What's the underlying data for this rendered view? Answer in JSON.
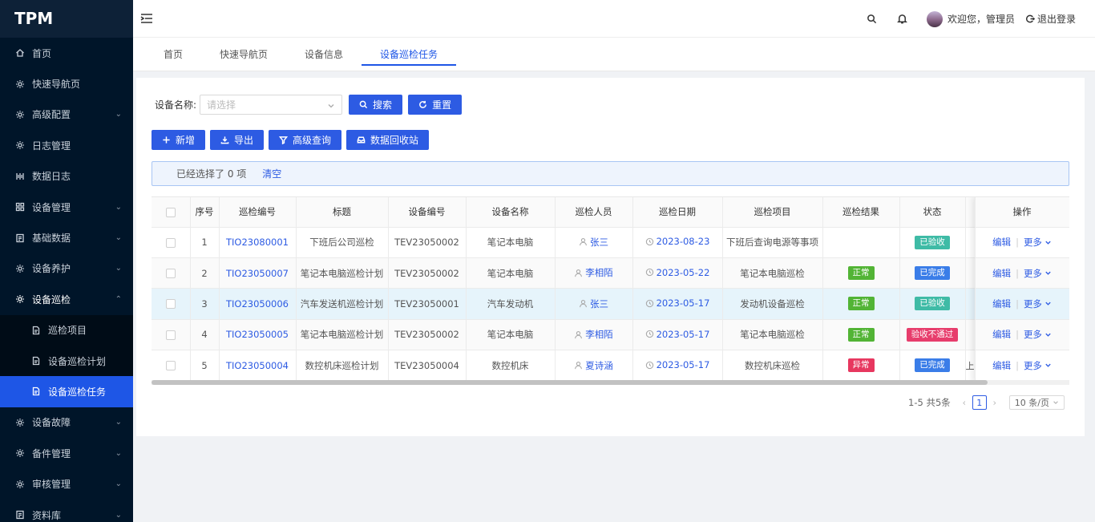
{
  "app": {
    "logo": "TPM"
  },
  "sidebar": {
    "items": [
      {
        "label": "首页",
        "icon": "home-icon"
      },
      {
        "label": "快速导航页",
        "icon": "gear-icon"
      },
      {
        "label": "高级配置",
        "icon": "gear-icon",
        "arrow": "⌄"
      },
      {
        "label": "日志管理",
        "icon": "gear-icon"
      },
      {
        "label": "数据日志",
        "icon": "data-icon"
      },
      {
        "label": "设备管理",
        "icon": "grid-icon",
        "arrow": "⌄"
      },
      {
        "label": "基础数据",
        "icon": "doc-icon",
        "arrow": "⌄"
      },
      {
        "label": "设备养护",
        "icon": "gear-icon",
        "arrow": "⌄"
      },
      {
        "label": "设备巡检",
        "icon": "gear-icon",
        "arrow": "⌃"
      },
      {
        "label": "设备故障",
        "icon": "gear-icon",
        "arrow": "⌄"
      },
      {
        "label": "备件管理",
        "icon": "gear-icon",
        "arrow": "⌄"
      },
      {
        "label": "审核管理",
        "icon": "gear-icon",
        "arrow": "⌄"
      },
      {
        "label": "资料库",
        "icon": "doc-icon",
        "arrow": "⌄"
      }
    ],
    "submenu": [
      {
        "label": "巡检项目"
      },
      {
        "label": "设备巡检计划"
      },
      {
        "label": "设备巡检任务"
      }
    ]
  },
  "header": {
    "welcome": "欢迎您，管理员",
    "logout": "退出登录"
  },
  "tabs": [
    {
      "label": "首页"
    },
    {
      "label": "快速导航页"
    },
    {
      "label": "设备信息"
    },
    {
      "label": "设备巡检任务"
    }
  ],
  "search": {
    "label": "设备名称:",
    "placeholder": "请选择",
    "search_btn": "搜索",
    "reset_btn": "重置"
  },
  "toolbar": {
    "add": "新增",
    "export": "导出",
    "advanced": "高级查询",
    "recycle": "数据回收站"
  },
  "alert": {
    "selected": "已经选择了 0 项",
    "clear": "清空"
  },
  "table": {
    "columns": [
      "序号",
      "巡检编号",
      "标题",
      "设备编号",
      "设备名称",
      "巡检人员",
      "巡检日期",
      "巡检项目",
      "巡检结果",
      "状态",
      "操作"
    ],
    "rows": [
      {
        "index": "1",
        "code": "TIO23080001",
        "title": "下班后公司巡检",
        "device_code": "TEV23050002",
        "device_name": "笔记本电脑",
        "inspector": "张三",
        "date": "2023-08-23",
        "project": "下班后查询电源等事项",
        "result": "",
        "status": "已验收"
      },
      {
        "index": "2",
        "code": "TIO23050007",
        "title": "笔记本电脑巡检计划",
        "device_code": "TEV23050002",
        "device_name": "笔记本电脑",
        "inspector": "李相陌",
        "date": "2023-05-22",
        "project": "笔记本电脑巡检",
        "result": "正常",
        "status": "已完成"
      },
      {
        "index": "3",
        "code": "TIO23050006",
        "title": "汽车发送机巡检计划",
        "device_code": "TEV23050001",
        "device_name": "汽车发动机",
        "inspector": "张三",
        "date": "2023-05-17",
        "project": "发动机设备巡检",
        "result": "正常",
        "status": "已验收"
      },
      {
        "index": "4",
        "code": "TIO23050005",
        "title": "笔记本电脑巡检计划",
        "device_code": "TEV23050002",
        "device_name": "笔记本电脑",
        "inspector": "李相陌",
        "date": "2023-05-17",
        "project": "笔记本电脑巡检",
        "result": "正常",
        "status": "验收不通过"
      },
      {
        "index": "5",
        "code": "TIO23050004",
        "title": "数控机床巡检计划",
        "device_code": "TEV23050004",
        "device_name": "数控机床",
        "inspector": "夏诗涵",
        "date": "2023-05-17",
        "project": "数控机床巡检",
        "result": "异常",
        "status": "已完成"
      }
    ],
    "edit": "编辑",
    "more": "更多",
    "hidden_col_glyph": "上"
  },
  "pagination": {
    "summary": "1-5 共5条",
    "current": "1",
    "page_size": "10 条/页"
  },
  "colors": {
    "primary": "#2d5be3",
    "sidebar": "#001529",
    "active_menu": "#1e56e6",
    "tag_normal": "#52b435",
    "tag_abnormal": "#e7375f",
    "tag_accepted": "#3fbba6",
    "tag_done": "#3a7de8",
    "tag_rejected": "#e73d6c"
  }
}
